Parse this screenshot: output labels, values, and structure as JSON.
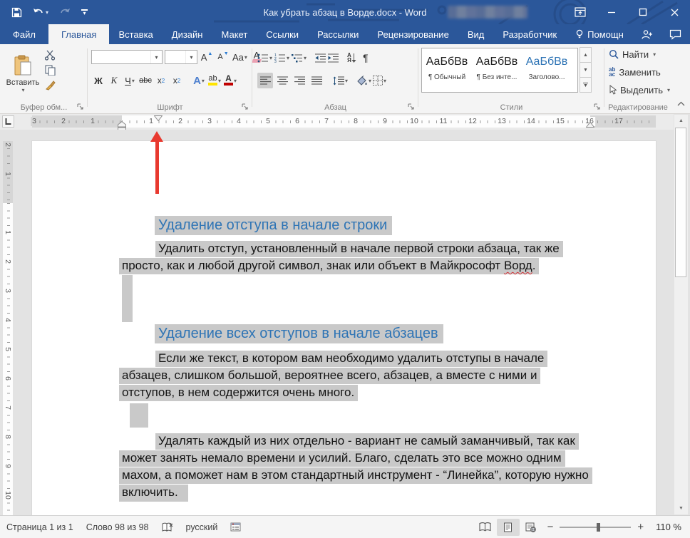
{
  "title_bar": {
    "title": "Как убрать абзац в Ворде.docx - Word"
  },
  "tabs": [
    "Файл",
    "Главная",
    "Вставка",
    "Дизайн",
    "Макет",
    "Ссылки",
    "Рассылки",
    "Рецензирование",
    "Вид",
    "Разработчик",
    "Помощн"
  ],
  "ribbon": {
    "clipboard": {
      "paste": "Вставить",
      "group": "Буфер обм..."
    },
    "font": {
      "group": "Шрифт",
      "font_name_value": "",
      "font_size_value": "",
      "grow": "A",
      "shrink": "A",
      "change_case": "Aa",
      "clear": "A",
      "bold": "Ж",
      "italic": "К",
      "underline": "Ч",
      "strikethrough": "abc",
      "sub_x": "x",
      "sub_2": "2",
      "sup_x": "x",
      "sup_2": "2",
      "effects": "A",
      "highlight": "ab",
      "color": "A"
    },
    "paragraph": {
      "group": "Абзац",
      "sort_top": "А",
      "sort_bottom": "Я",
      "pilcrow": "¶"
    },
    "styles": {
      "group": "Стили",
      "items": [
        {
          "sample": "АаБбВв",
          "name": "¶ Обычный"
        },
        {
          "sample": "АаБбВв",
          "name": "¶ Без инте..."
        },
        {
          "sample": "АаБбВв",
          "name": "Заголово..."
        }
      ]
    },
    "editing": {
      "group": "Редактирование",
      "find": "Найти",
      "replace": "Заменить",
      "replace_icon_top": "ab",
      "replace_icon_bottom": "ac",
      "select": "Выделить"
    }
  },
  "ruler": {
    "margin_left": [
      "3",
      "2",
      "1"
    ],
    "main": [
      "1",
      "2",
      "3",
      "4",
      "5",
      "6",
      "7",
      "8",
      "9",
      "10",
      "11",
      "12",
      "13",
      "14",
      "15",
      "16"
    ],
    "margin_right": [
      "17"
    ],
    "vertical_margin": [
      "2",
      "1"
    ],
    "vertical_main": [
      "1",
      "2",
      "3",
      "4",
      "5",
      "6",
      "7",
      "8",
      "9",
      "10"
    ]
  },
  "document": {
    "heading1": "Удаление отступа в начале строки",
    "p1l1": "Удалить отступ, установленный в начале первой строки абзаца, так же",
    "p1l2_pre": "просто, как и любой другой символ, знак или объект в Майкрософт ",
    "p1l2_word": "Ворд",
    "p1l2_post": ".",
    "heading2": "Удаление всех отступов в начале абзацев",
    "p2l1": "Если же текст, в котором вам необходимо удалить отступы в начале",
    "p2l2": "абзацев, слишком большой, вероятнее всего, абзацев, а вместе с ними и",
    "p2l3": "отступов, в нем содержится очень много.",
    "p3l1": "Удалять каждый из них отдельно - вариант не самый заманчивый, так как",
    "p3l2": "может занять немало времени и усилий. Благо, сделать это все можно одним",
    "p3l3": "махом, а поможет нам в этом стандартный инструмент - “Линейка”, которую нужно",
    "p3l4": "включить."
  },
  "status_bar": {
    "page": "Страница 1 из 1",
    "words": "Слово 98 из 98",
    "language": "русский",
    "zoom_level": "110 %"
  },
  "colors": {
    "titlebar_blue": "#2b579a",
    "heading_blue": "#2e74b5",
    "selection_gray": "#c9c9c9",
    "annotation_red": "#e8392f",
    "highlight_yellow": "#ffe400",
    "font_color_red": "#c00000"
  }
}
